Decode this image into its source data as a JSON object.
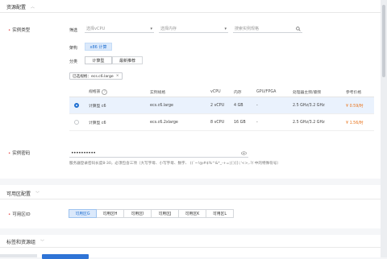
{
  "section_resource": {
    "title": "资源配置"
  },
  "instance_type": {
    "label": "实例类型",
    "filter_label": "筛选",
    "vcpu_placeholder": "选择vCPU",
    "memory_placeholder": "选择内存",
    "search_placeholder": "搜索实例规格",
    "arch_label": "架构",
    "arch_value": "x86 计算",
    "category_label": "分类",
    "categories": [
      "计算型",
      "最新推荐"
    ],
    "selected_tag": "已选规格：ecs.c6.large"
  },
  "table": {
    "headers": [
      "规格族",
      "实例规格",
      "vCPU",
      "内存",
      "GPU/FPGA",
      "处理器主频/睿频",
      "参考价格"
    ],
    "rows": [
      {
        "family": "计算型 c6",
        "spec": "ecs.c6.large",
        "vcpu": "2 vCPU",
        "memory": "4 GB",
        "gpu": "-",
        "cpu": "2.5 GHz/3.2 GHz",
        "price": "¥ 0.59/时",
        "selected": true
      },
      {
        "family": "计算型 c6",
        "spec": "ecs.c6.2xlarge",
        "vcpu": "8 vCPU",
        "memory": "16 GB",
        "gpu": "-",
        "cpu": "2.5 GHz/3.2 GHz",
        "price": "¥ 1.56/时",
        "selected": false
      }
    ]
  },
  "password": {
    "label": "实例密码",
    "value": "••••••••••",
    "hint": "服务器登录密码长度8-30，必须包含三项（大写字母、小写字母、数字、 ()`~!@#$%^&*_-+=|{}[]:;'<>,.?/ 中的特殊符号）"
  },
  "section_az": {
    "title": "可用区配置"
  },
  "availability_zone": {
    "label": "可用区ID",
    "zones": [
      "可用区G",
      "可用区H",
      "可用区I",
      "可用区J",
      "可用区K",
      "可用区L"
    ],
    "active_index": 0
  },
  "section_tags": {
    "title": "标签和资源组"
  },
  "colors": {
    "accent": "#1f6fd1",
    "required": "#e54545",
    "price": "#e8731a"
  }
}
